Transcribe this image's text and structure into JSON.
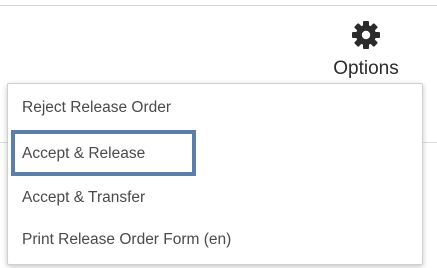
{
  "options": {
    "label": "Options",
    "icon": "gear-icon"
  },
  "menu": {
    "items": [
      {
        "label": "Reject Release Order"
      },
      {
        "label": "Accept & Release",
        "highlighted": true
      },
      {
        "label": "Accept & Transfer"
      },
      {
        "label": "Print Release Order Form (en)"
      }
    ]
  },
  "colors": {
    "highlight_border": "#5b7fa8",
    "text": "#4a4a4a",
    "icon": "#2b2b2b"
  }
}
